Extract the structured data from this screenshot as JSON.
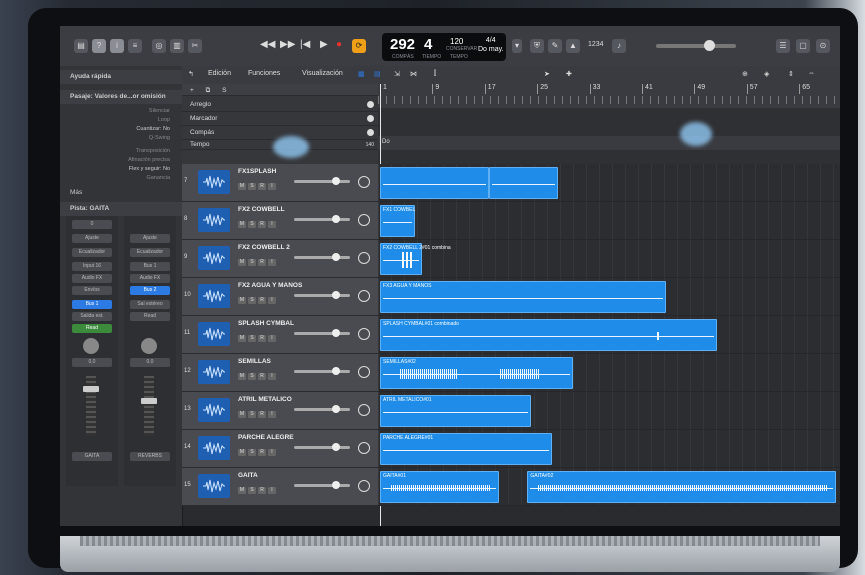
{
  "control_bar": {
    "position": "292",
    "beat": "4",
    "position_label": "COMPÁS",
    "beat_label": "TIEMPO",
    "tempo": "120",
    "tempo_label": "CONSERVAR",
    "tempo_label2": "TEMPO",
    "time_signature": "4/4",
    "key": "Do may.",
    "count_in": "1234"
  },
  "inspector": {
    "quick_help": "Ayuda rápida",
    "region_header": "Pasaje: Valores de...or omisión",
    "params": [
      "Silenciar",
      "Loop",
      "Cuantizar: No",
      "Q-Swing",
      "Transposición",
      "Afinación precisa",
      "Flex y seguir: No",
      "Ganancia"
    ],
    "more": "Más",
    "track_header": "Pista: GAITA",
    "strip_left": {
      "value": "0",
      "setting": "Ajuste",
      "eq": "Ecualizador",
      "input": "Input 16",
      "fx": "Audio FX",
      "sends": "Envíos",
      "bus": "Bus 1",
      "stereo": "Salida est.",
      "group": "Grupo",
      "read": "Read",
      "pan_value": "0,0",
      "name": "GAITA"
    },
    "strip_right": {
      "setting": "Ajuste",
      "eq": "Ecualizador",
      "bus1": "Bus 1",
      "fx": "Audio FX",
      "bus2": "Bus 2",
      "stereo": "Sal estéreo",
      "read": "Read",
      "pan_value": "0,0",
      "name": "REVERBS"
    }
  },
  "toolbar": {
    "edit": "Edición",
    "functions": "Funciones",
    "view": "Visualización"
  },
  "ruler": {
    "bars": [
      "1",
      "9",
      "17",
      "25",
      "33",
      "41",
      "49",
      "57",
      "65"
    ]
  },
  "global_tracks": {
    "rows": [
      "Arreglo",
      "Marcador",
      "Compás",
      "Tempo"
    ],
    "tempo_value": "140",
    "key_marker": "Do"
  },
  "tracks": [
    {
      "num": "7",
      "name": "FX1SPLASH",
      "regions": []
    },
    {
      "num": "8",
      "name": "FX2 COWBELL",
      "regions": [
        {
          "label": "FX1 COWBEL",
          "start": 1,
          "end": 6.3
        }
      ]
    },
    {
      "num": "9",
      "name": "FX2 COWBELL 2",
      "regions": [
        {
          "label": "FX2 COWBELL 2#01 combina",
          "start": 1,
          "end": 7.4
        }
      ]
    },
    {
      "num": "10",
      "name": "FX2 AGUA Y MANOS",
      "regions": [
        {
          "label": "FX3 AGUA Y MANOS",
          "start": 1,
          "end": 44.6
        }
      ]
    },
    {
      "num": "11",
      "name": "SPLASH CYMBAL",
      "regions": [
        {
          "label": "SPLASH CYMBAL#01 combinado",
          "start": 1,
          "end": 52.4
        }
      ]
    },
    {
      "num": "12",
      "name": "SEMILLAS",
      "regions": [
        {
          "label": "SEMILLAS#02",
          "start": 1,
          "end": 30.4
        }
      ]
    },
    {
      "num": "13",
      "name": "ATRIL METALICO",
      "regions": [
        {
          "label": "ATRIL METALICO#01",
          "start": 1,
          "end": 24.1
        }
      ]
    },
    {
      "num": "14",
      "name": "PARCHE ALEGRE",
      "regions": [
        {
          "label": "PARCHE ALEGRE#01",
          "start": 1,
          "end": 27.3
        }
      ]
    },
    {
      "num": "15",
      "name": "GAITA",
      "regions": [
        {
          "label": "GAITA#01",
          "start": 1,
          "end": 19.2
        },
        {
          "label": "GAITA#02",
          "start": 23.5,
          "end": 70.6
        }
      ]
    }
  ],
  "first_track_regions": [
    {
      "start": 1,
      "end": 17.6
    },
    {
      "start": 17.6,
      "end": 28.2
    }
  ],
  "colors": {
    "region": "#1e8ce8",
    "accent": "#2c7be5",
    "record": "#e5302b",
    "cycle": "#f0a018"
  }
}
